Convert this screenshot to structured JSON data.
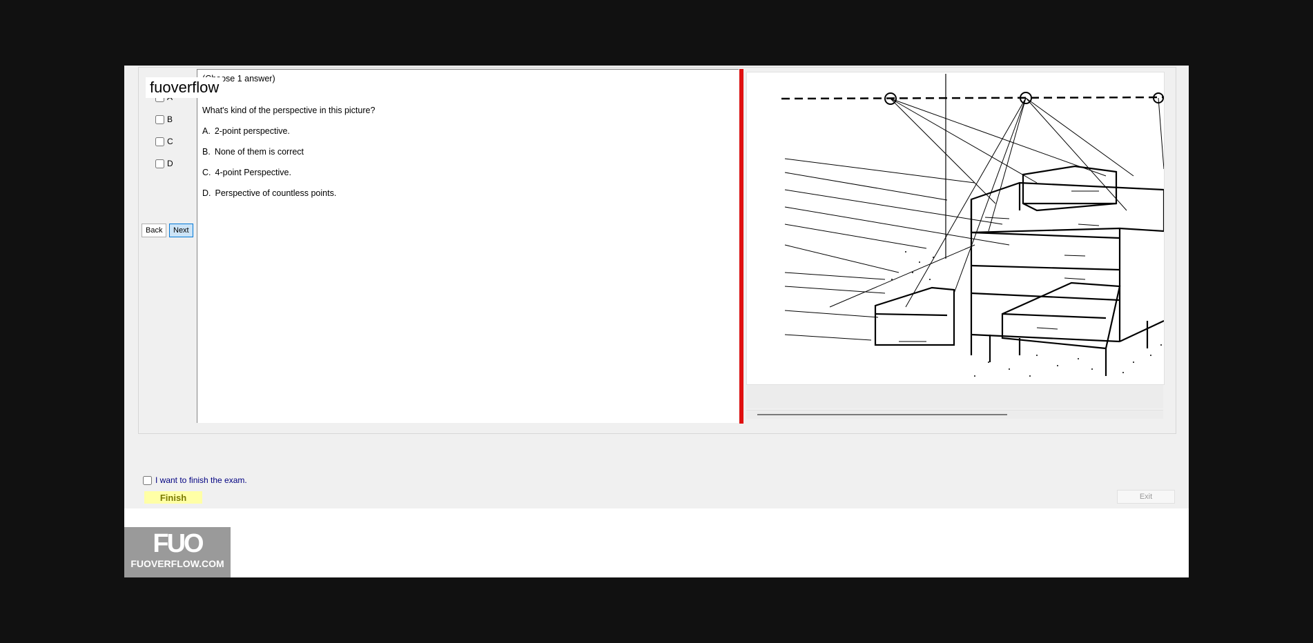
{
  "watermark": "fuoverflow",
  "answers": {
    "partial_label": "A",
    "options": [
      "B",
      "C",
      "D"
    ]
  },
  "nav": {
    "back": "Back",
    "next": "Next"
  },
  "question": {
    "instruction": "(Choose 1 answer)",
    "text": "What's kind of the perspective in this picture?",
    "options": [
      {
        "letter": "A.",
        "text": "2-point perspective."
      },
      {
        "letter": "B.",
        "text": "None of them is correct"
      },
      {
        "letter": "C.",
        "text": "4-point Perspective."
      },
      {
        "letter": "D.",
        "text": "Perspective of countless points."
      }
    ]
  },
  "finish": {
    "checkbox_label": "I want to finish the exam.",
    "finish_button": "Finish",
    "exit_button": "Exit"
  },
  "logo": {
    "mark": "FUO",
    "site": "FUOVERFLOW.COM"
  }
}
